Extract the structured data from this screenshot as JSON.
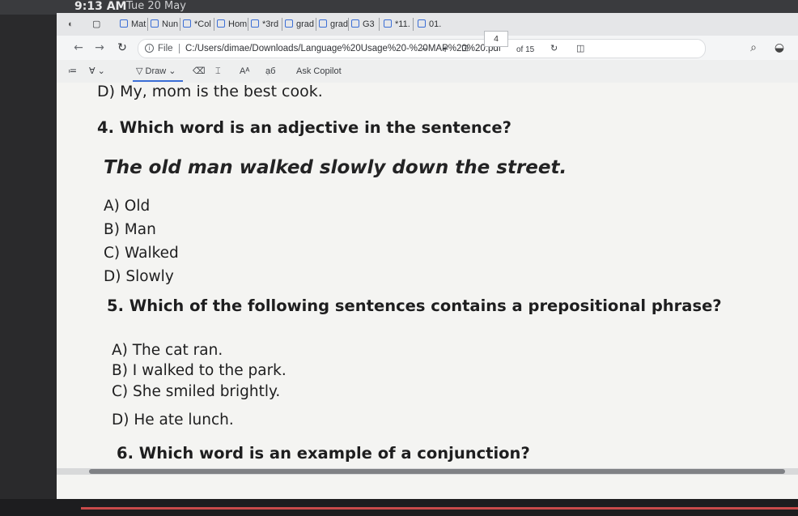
{
  "status": {
    "time": "9:13 AM",
    "date": "Tue 20 May"
  },
  "tabs": [
    {
      "label": "Mat"
    },
    {
      "label": "Nun"
    },
    {
      "label": "*Col"
    },
    {
      "label": "Hom"
    },
    {
      "label": "*3rd"
    },
    {
      "label": "grad"
    },
    {
      "label": "grad"
    },
    {
      "label": "G3"
    },
    {
      "label": "*11."
    },
    {
      "label": "01."
    }
  ],
  "address": {
    "file_label": "File",
    "url": "C:/Users/dimae/Downloads/Language%20Usage%20-%20MAP%20%20.pdf"
  },
  "pdf_toolbar": {
    "draw_label": "Draw",
    "copilot_label": "Ask Copilot",
    "page_current": "4",
    "page_total": "of 15",
    "zoom_minus": "−",
    "zoom_plus": "+"
  },
  "content": {
    "prev_option_d": "D) My, mom is the best cook.",
    "q4": {
      "question": "4. Which word is an adjective in the sentence?",
      "sentence": "The old man walked slowly down the street.",
      "options": [
        "A) Old",
        "B) Man",
        "C) Walked",
        "D) Slowly"
      ]
    },
    "q5": {
      "question": "5. Which of the following sentences contains a prepositional phrase?",
      "options": [
        "A) The cat ran.",
        "B) I walked to the park.",
        "C) She smiled brightly.",
        "D) He ate lunch."
      ]
    },
    "q6": {
      "question": "6. Which word is an example of a conjunction?"
    }
  }
}
